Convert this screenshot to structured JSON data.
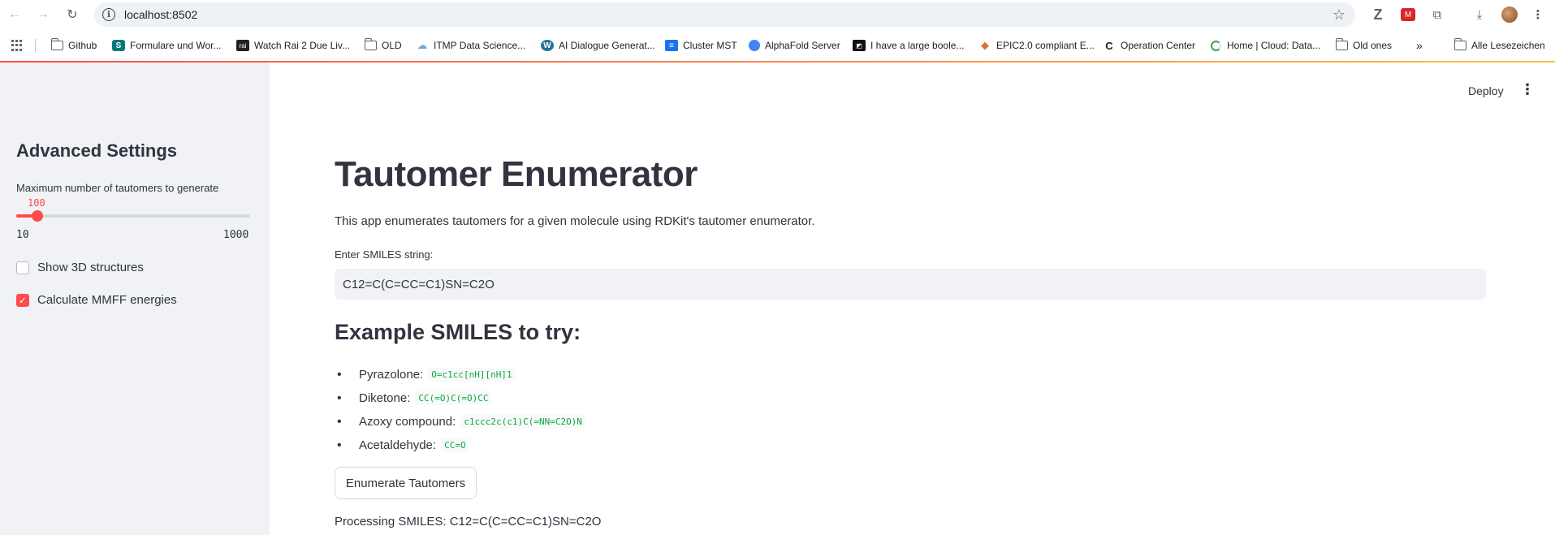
{
  "browser": {
    "url": "localhost:8502",
    "bookmarks": [
      {
        "label": "Github",
        "icon": "folder-icon"
      },
      {
        "label": "Formulare und Wor...",
        "icon": "sharepoint-icon"
      },
      {
        "label": "Watch Rai 2 Due Liv...",
        "icon": "rai-icon"
      },
      {
        "label": "OLD",
        "icon": "folder-icon"
      },
      {
        "label": "ITMP Data Science...",
        "icon": "cloud-icon"
      },
      {
        "label": "AI Dialogue Generat...",
        "icon": "wordpress-icon"
      },
      {
        "label": "Cluster MST",
        "icon": "sheet-icon"
      },
      {
        "label": "AlphaFold Server",
        "icon": "alphafold-icon"
      },
      {
        "label": "I have a large boole...",
        "icon": "site-icon"
      },
      {
        "label": "EPIC2.0 compliant E...",
        "icon": "epic-icon"
      },
      {
        "label": "Operation Center",
        "icon": "operation-icon"
      },
      {
        "label": "Home | Cloud: Data...",
        "icon": "loading-icon"
      },
      {
        "label": "Old ones",
        "icon": "folder-icon"
      }
    ],
    "more_bookmarks": "»",
    "all_bookmarks": "Alle Lesezeichen"
  },
  "sidebar": {
    "title": "Advanced Settings",
    "slider": {
      "label": "Maximum number of tautomers to generate",
      "value": "100",
      "min": "10",
      "max": "1000",
      "fraction": 0.091
    },
    "checkboxes": [
      {
        "label": "Show 3D structures",
        "checked": false
      },
      {
        "label": "Calculate MMFF energies",
        "checked": true
      }
    ]
  },
  "header": {
    "deploy_label": "Deploy",
    "menu_icon": "⋮"
  },
  "main": {
    "title": "Tautomer Enumerator",
    "description": "This app enumerates tautomers for a given molecule using RDKit's tautomer enumerator.",
    "input_label": "Enter SMILES string:",
    "input_value": "C12=C(C=CC=C1)SN=C2O",
    "examples_heading": "Example SMILES to try:",
    "examples": [
      {
        "name": "Pyrazolone:",
        "smiles": "O=c1cc[nH][nH]1"
      },
      {
        "name": "Diketone:",
        "smiles": "CC(=O)C(=O)CC"
      },
      {
        "name": "Azoxy compound:",
        "smiles": "c1ccc2c(c1)C(=NN=C2O)N"
      },
      {
        "name": "Acetaldehyde:",
        "smiles": "CC=O"
      }
    ],
    "button_label": "Enumerate Tautomers",
    "processing_text": "Processing SMILES: C12=C(C=CC=C1)SN=C2O"
  },
  "colors": {
    "accent": "#ff4b4b",
    "sidebar_bg": "#f0f2f6",
    "code_green": "#09ab3b"
  }
}
